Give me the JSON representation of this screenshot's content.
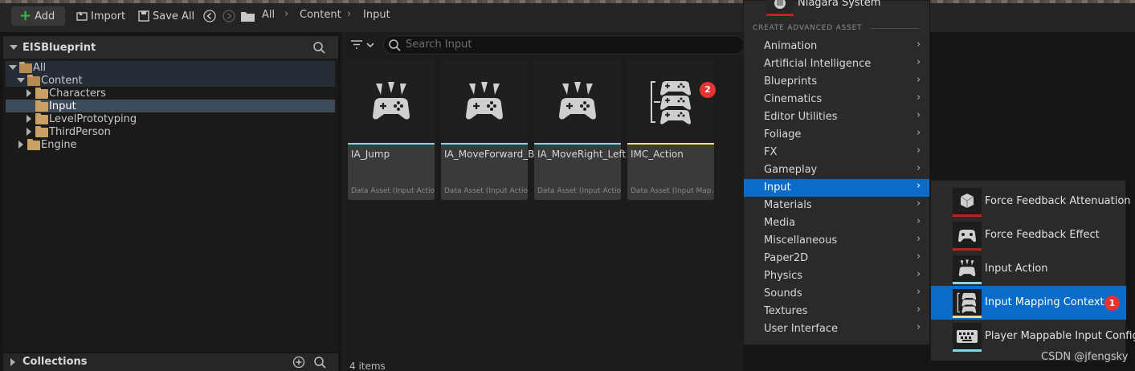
{
  "toolbar": {
    "add_label": "Add",
    "import_label": "Import",
    "save_all_label": "Save All",
    "breadcrumb": [
      "All",
      "Content",
      "Input"
    ]
  },
  "left_panel": {
    "title": "EISBlueprint",
    "tree": [
      "All",
      "Content",
      "Characters",
      "Input",
      "LevelPrototyping",
      "ThirdPerson",
      "Engine"
    ],
    "collections_label": "Collections"
  },
  "content": {
    "search_placeholder": "Search Input",
    "assets": [
      {
        "name": "IA_Jump",
        "type": "Data Asset (Input Action)",
        "bar_color": "#7fd7e8"
      },
      {
        "name": "IA_MoveForward_Bacword",
        "type": "Data Asset (Input Action)",
        "bar_color": "#7fd7e8"
      },
      {
        "name": "IA_MoveRight_Left",
        "type": "Data Asset (Input Action)",
        "bar_color": "#7fd7e8"
      },
      {
        "name": "IMC_Action",
        "type": "Data Asset (Input Map...",
        "bar_color": "#f0e27a"
      }
    ],
    "badge_2": "2",
    "items_count": "4 items"
  },
  "menu": {
    "top_item": "Niagara System",
    "section_title": "CREATE ADVANCED ASSET",
    "items": [
      "Animation",
      "Artificial Intelligence",
      "Blueprints",
      "Cinematics",
      "Editor Utilities",
      "Foliage",
      "FX",
      "Gameplay",
      "Input",
      "Materials",
      "Media",
      "Miscellaneous",
      "Paper2D",
      "Physics",
      "Sounds",
      "Textures",
      "User Interface"
    ],
    "active_item": "Input",
    "arrow": "›"
  },
  "submenu": {
    "items": [
      "Force Feedback Attenuation",
      "Force Feedback Effect",
      "Input Action",
      "Input Mapping Context",
      "Player Mappable Input Config"
    ],
    "active_item": "Input Mapping Context",
    "badge_1": "1"
  },
  "watermark": "CSDN @jfengsky",
  "colors": {
    "accent": "#0a6bc9",
    "badge": "#e5332f",
    "input_action_bar": "#7fd7e8",
    "mapping_bar": "#f0e27a",
    "force_feedback_bar": "#c0211f"
  }
}
